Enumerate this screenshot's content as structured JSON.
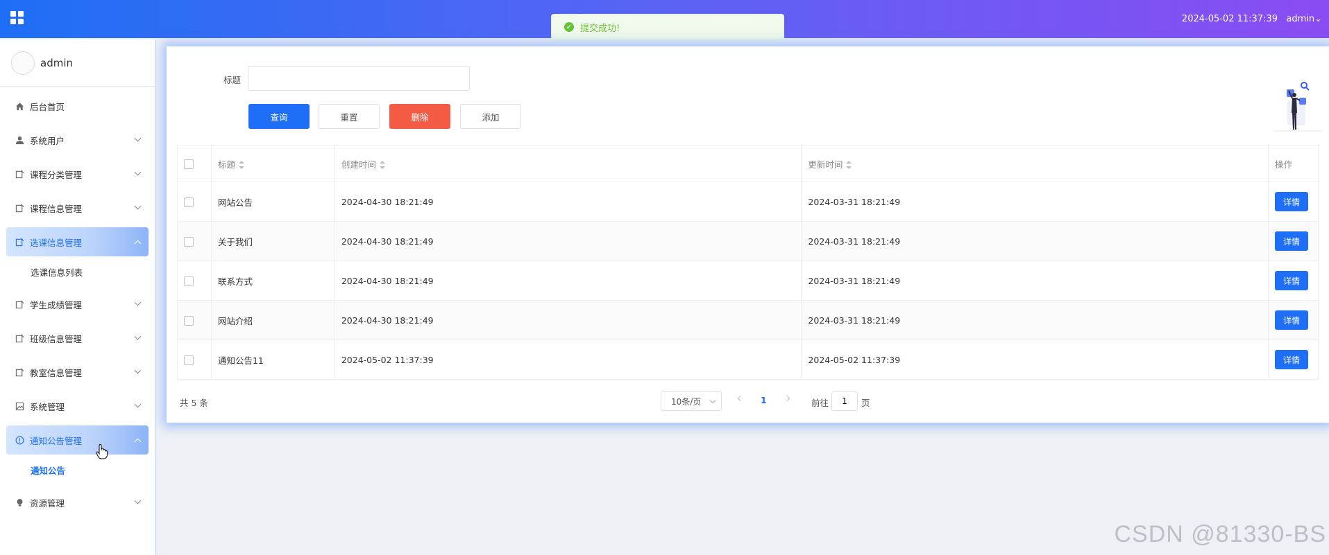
{
  "header": {
    "datetime": "2024-05-02 11:37:39",
    "user": "admin"
  },
  "toast": {
    "message": "提交成功!"
  },
  "sidebar": {
    "profile_name": "admin",
    "items": [
      {
        "label": "后台首页",
        "icon": "home-icon"
      },
      {
        "label": "系统用户",
        "icon": "user-icon"
      },
      {
        "label": "课程分类管理",
        "icon": "doc-icon"
      },
      {
        "label": "课程信息管理",
        "icon": "doc-icon"
      },
      {
        "label": "选课信息管理",
        "icon": "doc-icon",
        "active": true,
        "sub": "选课信息列表"
      },
      {
        "label": "学生成绩管理",
        "icon": "doc-icon"
      },
      {
        "label": "班级信息管理",
        "icon": "doc-icon"
      },
      {
        "label": "教室信息管理",
        "icon": "doc-icon"
      },
      {
        "label": "系统管理",
        "icon": "image-icon"
      },
      {
        "label": "通知公告管理",
        "icon": "info-icon",
        "active": true,
        "sub": "通知公告"
      },
      {
        "label": "资源管理",
        "icon": "bulb-icon"
      }
    ]
  },
  "search": {
    "label": "标题",
    "value": "",
    "placeholder": ""
  },
  "toolbar": {
    "query": "查询",
    "reset": "重置",
    "delete": "删除",
    "add": "添加"
  },
  "table": {
    "columns": [
      "标题",
      "创建时间",
      "更新时间",
      "操作"
    ],
    "rows": [
      {
        "title": "网站公告",
        "created": "2024-04-30 18:21:49",
        "updated": "2024-03-31 18:21:49",
        "action": "详情"
      },
      {
        "title": "关于我们",
        "created": "2024-04-30 18:21:49",
        "updated": "2024-03-31 18:21:49",
        "action": "详情"
      },
      {
        "title": "联系方式",
        "created": "2024-04-30 18:21:49",
        "updated": "2024-03-31 18:21:49",
        "action": "详情"
      },
      {
        "title": "网站介绍",
        "created": "2024-04-30 18:21:49",
        "updated": "2024-03-31 18:21:49",
        "action": "详情"
      },
      {
        "title": "通知公告11",
        "created": "2024-05-02 11:37:39",
        "updated": "2024-05-02 11:37:39",
        "action": "详情"
      }
    ]
  },
  "pagination": {
    "total": "共 5 条",
    "page_size": "10条/页",
    "current_page": "1",
    "goto_label": "前往",
    "goto_value": "1",
    "goto_suffix": "页"
  },
  "colors": {
    "primary": "#1e6ff5",
    "danger": "#f35b45",
    "success": "#67c23a"
  },
  "watermark": "CSDN @81330-BS"
}
